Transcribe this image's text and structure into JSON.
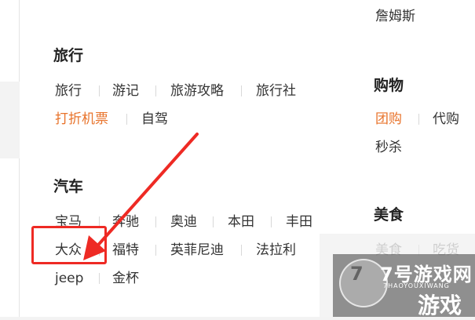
{
  "top_cut": "詹姆斯",
  "travel": {
    "title": "旅行",
    "items": [
      "旅行",
      "游记",
      "旅游攻略",
      "旅行社",
      "打折机票",
      "自驾"
    ]
  },
  "shopping": {
    "title": "购物",
    "items": [
      "团购",
      "代购",
      "秒杀"
    ]
  },
  "car": {
    "title": "汽车",
    "items": [
      "宝马",
      "奔驰",
      "奥迪",
      "本田",
      "丰田",
      "大众",
      "福特",
      "英菲尼迪",
      "法拉利",
      "jeep",
      "金杯"
    ]
  },
  "food": {
    "title": "美食",
    "items": [
      "美食",
      "吃货"
    ]
  },
  "partial_char": "7",
  "watermark": {
    "line1": "7号游戏网",
    "line2": "7HAOYOUXIWANG",
    "line3": "游戏"
  },
  "colors": {
    "highlight": "#e8732b",
    "annotation": "#ee2a24"
  }
}
